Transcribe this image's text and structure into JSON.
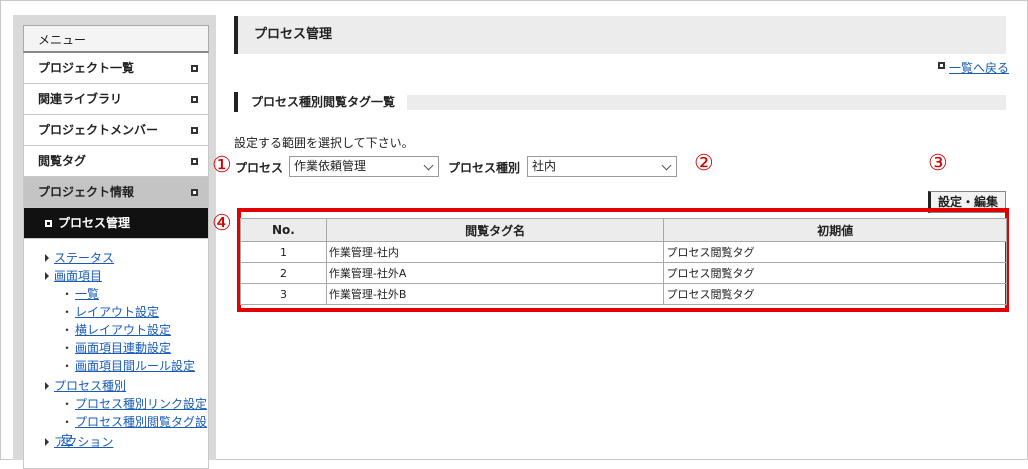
{
  "sidebar": {
    "menu_heading": "メニュー",
    "items": [
      {
        "label": "プロジェクト一覧"
      },
      {
        "label": "関連ライブラリ"
      },
      {
        "label": "プロジェクトメンバー"
      },
      {
        "label": "閲覧タグ"
      }
    ],
    "section_label": "プロジェクト情報",
    "active_label": "プロセス管理",
    "sub": {
      "status": "ステータス",
      "screen_items": "画面項目",
      "list": "一覧",
      "layout": "レイアウト設定",
      "h_layout": "横レイアウト設定",
      "link_setting": "画面項目連動設定",
      "rule_setting": "画面項目間ルール設定",
      "process_type": "プロセス種別",
      "type_link": "プロセス種別リンク設定",
      "type_tag": "プロセス種別閲覧タグ設定",
      "action": "アクション"
    }
  },
  "header": {
    "title": "プロセス管理",
    "back_link": "一覧へ戻る"
  },
  "section": {
    "title": "プロセス種別閲覧タグ一覧",
    "instruction": "設定する範囲を選択して下さい。"
  },
  "filters": {
    "process_label": "プロセス",
    "process_value": "作業依頼管理",
    "type_label": "プロセス種別",
    "type_value": "社内"
  },
  "edit_button": "設定・編集",
  "markers": [
    "①",
    "②",
    "③",
    "④"
  ],
  "table": {
    "headers": [
      "No.",
      "閲覧タグ名",
      "初期値"
    ],
    "rows": [
      [
        "1",
        "作業管理-社内",
        "プロセス閲覧タグ"
      ],
      [
        "2",
        "作業管理-社外A",
        "プロセス閲覧タグ"
      ],
      [
        "3",
        "作業管理-社外B",
        "プロセス閲覧タグ"
      ]
    ]
  },
  "colors": {
    "highlight": "#e30000",
    "link": "#1a5bb8",
    "active_bg": "#111111"
  }
}
